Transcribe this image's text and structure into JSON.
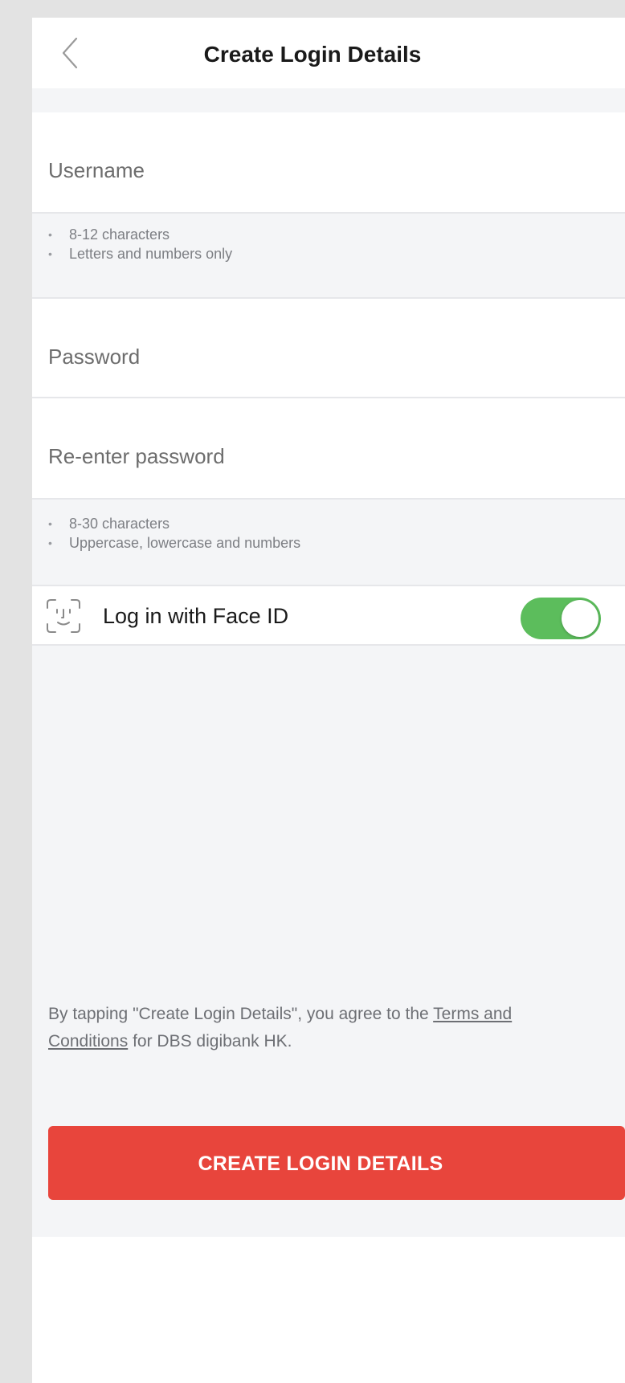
{
  "header": {
    "title": "Create Login Details",
    "back_icon": "chevron-left-icon"
  },
  "form": {
    "username_placeholder": "Username",
    "username_hints": [
      "8-12 characters",
      "Letters and numbers only"
    ],
    "password_placeholder": "Password",
    "reenter_password_placeholder": "Re-enter password",
    "password_hints": [
      "8-30 characters",
      "Uppercase, lowercase and numbers"
    ]
  },
  "face_id": {
    "icon": "face-id-icon",
    "label": "Log in with Face ID",
    "enabled": true
  },
  "terms": {
    "prefix": "By tapping \"Create Login Details\", you agree to the ",
    "link_text": "Terms and Conditions",
    "suffix": " for DBS digibank HK."
  },
  "actions": {
    "create_button_label": "CREATE LOGIN DETAILS"
  },
  "colors": {
    "primary": "#e8453c",
    "toggle_on": "#5cbd5c",
    "background": "#f4f5f7"
  }
}
